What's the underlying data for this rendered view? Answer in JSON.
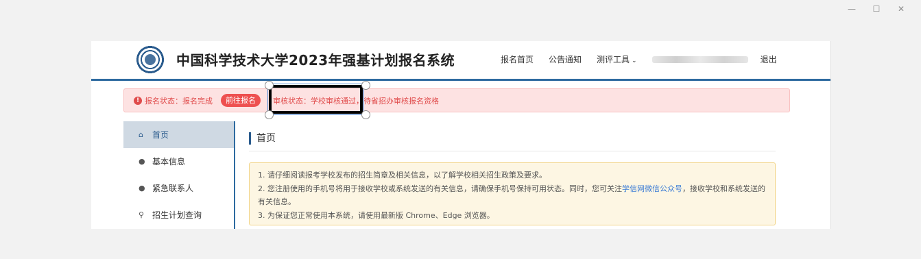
{
  "window": {
    "minimize": "—",
    "maximize": "☐",
    "close": "✕"
  },
  "header": {
    "site_title": "中国科学技术大学2023年强基计划报名系统",
    "nav": {
      "home": "报名首页",
      "notice": "公告通知",
      "tools": "测评工具",
      "logout": "退出"
    }
  },
  "status": {
    "registration": "报名状态：报名完成",
    "go_button": "前往报名",
    "review": "审核状态：学校审核通过，待省招办审核报名资格"
  },
  "sidebar": {
    "items": [
      {
        "label": "首页",
        "icon": "home-icon"
      },
      {
        "label": "基本信息",
        "icon": "user-icon"
      },
      {
        "label": "紧急联系人",
        "icon": "user-icon"
      },
      {
        "label": "招生计划查询",
        "icon": "search-icon"
      }
    ]
  },
  "content": {
    "heading": "首页",
    "line1": "1. 请仔细阅读报考学校发布的招生简章及相关信息，以了解学校相关招生政策及要求。",
    "line2_before": "2. 您注册使用的手机号将用于接收学校或系统发送的有关信息，请确保手机号保持可用状态。同时，您可关注",
    "line2_link": "学信网微信公众号",
    "line2_after": "，接收学校和系统发送的有关信息。",
    "line3": "3. 为保证您正常使用本系统，请使用最新版 Chrome、Edge 浏览器。"
  },
  "colors": {
    "accent": "#2d6aa0",
    "alert": "#e04b4b",
    "button": "#ee4f4f"
  }
}
